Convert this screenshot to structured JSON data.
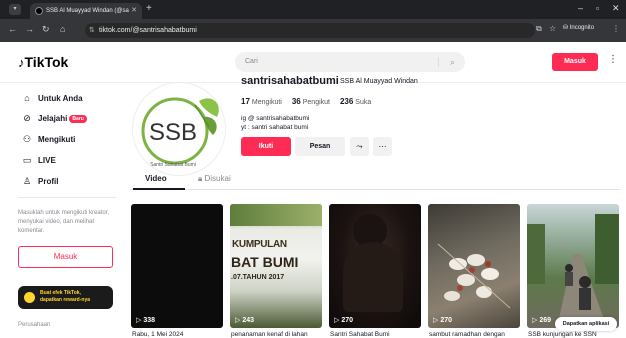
{
  "browser": {
    "tab_title": "SSB Al Muayyad Windan (@sa",
    "url": "tiktok.com/@santrisahabatbumi",
    "incognito_label": "Incognito"
  },
  "header": {
    "logo": "TikTok",
    "search_placeholder": "Cari",
    "login_label": "Masuk"
  },
  "sidebar": {
    "items": [
      {
        "label": "Untuk Anda",
        "icon": "home-icon"
      },
      {
        "label": "Jelajahi",
        "icon": "compass-icon",
        "badge": "Baru"
      },
      {
        "label": "Mengikuti",
        "icon": "following-icon"
      },
      {
        "label": "LIVE",
        "icon": "live-icon"
      },
      {
        "label": "Profil",
        "icon": "profile-icon"
      }
    ],
    "login_prompt": "Masuklah untuk mengikuti kreator, menyukai video, dan melihat komentar.",
    "login_button": "Masuk",
    "effect_card_line1": "Buat efek TikTok,",
    "effect_card_line2": "dapatkan reward-nya",
    "company": "Perusahaan"
  },
  "profile": {
    "avatar_text": "SSB",
    "avatar_subtext": "Santri Sahabat Bumi",
    "username": "santrisahabatbumi",
    "nickname": "SSB Al Muayyad Windan",
    "following_count": "17",
    "following_label": "Mengikuti",
    "followers_count": "36",
    "followers_label": "Pengikut",
    "likes_count": "236",
    "likes_label": "Suka",
    "bio_line1": "ig @ santrisahabatbumi",
    "bio_line2": "yt : santri sahabat bumi",
    "follow_label": "Ikuti",
    "message_label": "Pesan"
  },
  "tabs": {
    "video": "Video",
    "liked": "Disukai"
  },
  "videos": [
    {
      "views": "338",
      "caption": "Rabu, 1 Mei 2024"
    },
    {
      "views": "243",
      "caption": "penanaman kenaf di lahan",
      "overlay1": "KUMPULAN",
      "overlay2": "BAT BUMI",
      "overlay3": ".07.TAHUN 2017"
    },
    {
      "views": "270",
      "caption": "Santri Sahabat Bumi"
    },
    {
      "views": "270",
      "caption": "sambut ramadhan dengan"
    },
    {
      "views": "269",
      "caption": "SSB kunjungan ke SSN"
    }
  ],
  "get_app_label": "Dapatkan aplikasi",
  "colors": {
    "accent": "#fe2c55",
    "text": "#161823",
    "muted": "#8a8b91"
  }
}
